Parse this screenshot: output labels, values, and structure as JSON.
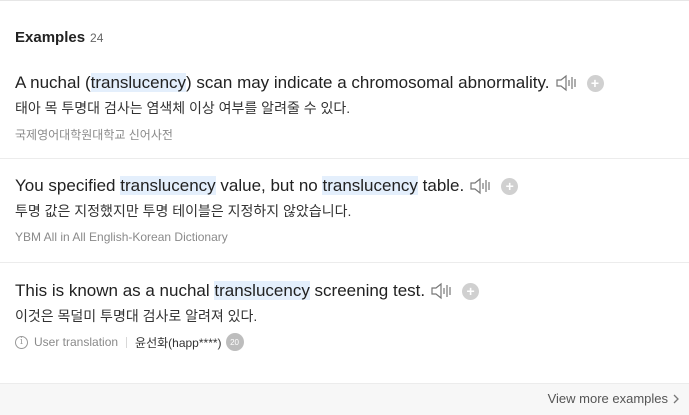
{
  "section": {
    "title": "Examples",
    "count": "24"
  },
  "examples": [
    {
      "en": {
        "before": "A nuchal (",
        "highlight": "translucency",
        "after": ") scan may indicate a chromosomal abnormality."
      },
      "ko": "태아 목 투명대 검사는 염색체 이상 여부를 알려줄 수 있다.",
      "source": "국제영어대학원대학교 신어사전"
    },
    {
      "en": {
        "before": "You specified ",
        "highlight": "translucency",
        "middle": " value, but no ",
        "highlight2": "translucency",
        "after": " table."
      },
      "ko": "투명 값은 지정했지만 투명 테이블은 지정하지 않았습니다.",
      "source": "YBM All in All English-Korean Dictionary"
    },
    {
      "en": {
        "before": "This is known as a nuchal ",
        "highlight": "translucency",
        "after": " screening test."
      },
      "ko": "이것은 목덜미 투명대 검사로 알려져 있다.",
      "source": "User translation",
      "user": "윤선화(happ****)",
      "user_badge": "20"
    }
  ],
  "footer": {
    "more_label": "View more examples"
  },
  "icons": {
    "speaker": "speaker-icon",
    "plus": "plus-icon",
    "info": "info-icon",
    "chevron": "chevron-right-icon"
  },
  "colors": {
    "highlight": "#e4effc",
    "muted": "#8a8a8a",
    "button": "#d0d0d0"
  }
}
